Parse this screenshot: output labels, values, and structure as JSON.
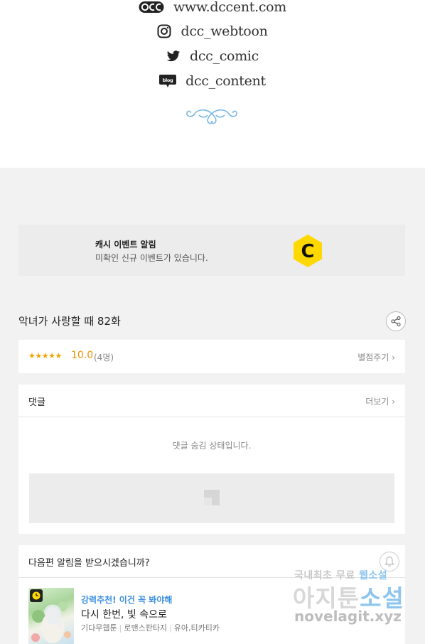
{
  "publisher": {
    "website": "www.dccent.com",
    "instagram": "dcc_webtoon",
    "twitter": "dcc_comic",
    "blog": "dcc_content",
    "icons": [
      "dcc-logo-icon",
      "instagram-icon",
      "twitter-icon",
      "blog-icon",
      "flourish-ornament"
    ]
  },
  "event_banner": {
    "title": "캐시 이벤트 알림",
    "message": "미확인 신규 이벤트가 있습니다.",
    "logo_letter": "C",
    "accent_color": "#ffd800"
  },
  "episode": {
    "title": "악녀가 사랑할 때 82화"
  },
  "rating": {
    "stars": "★★★★★",
    "score": "10.0",
    "count": "(4명)",
    "rate_link": "별점주기 ›"
  },
  "comments": {
    "label": "댓글",
    "more": "더보기 ›",
    "hidden_message": "댓글 숨김 상태입니다."
  },
  "next_alert": {
    "question": "다음편 알림을 받으시겠습니까?",
    "recommendation": {
      "tag": "강력추천! 이건 꼭 봐야해",
      "title": "다시 한번, 빛 속으로",
      "meta": [
        "기다무웹툰",
        "로맨스판타지",
        "유아,티카티카"
      ]
    }
  },
  "watermark": {
    "line1_a": "국내최초 무료 ",
    "line1_b": "웹소설",
    "line2_a": "아지툰",
    "line2_b": "소설",
    "line3": "novelagit.xyz"
  }
}
